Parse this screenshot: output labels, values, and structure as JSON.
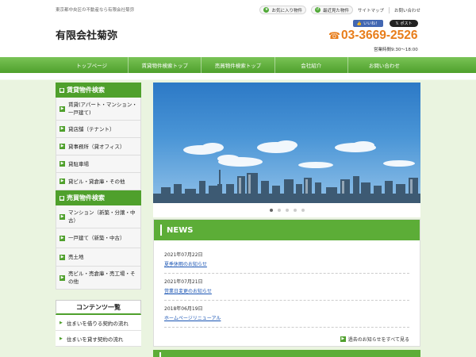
{
  "header": {
    "tagline": "東京都中央区の不動産なら有限会社菊弥",
    "logo": "有限会社菊弥",
    "phone": "03-3669-2526",
    "hours": "営業時間9:30～18:00",
    "util": {
      "favorites": "お気に入り物件",
      "recent": "最近見た物件",
      "sitemap": "サイトマップ",
      "contact": "お問い合わせ"
    },
    "social": {
      "facebook": "いいね！",
      "twitter": "ポスト"
    }
  },
  "nav": [
    "トップページ",
    "賃貸物件検索トップ",
    "売買物件検索トップ",
    "会社紹介",
    "お問い合わせ"
  ],
  "sidebar": {
    "rental_title": "賃貸物件検索",
    "rental_items": [
      "賃貸(アパート・マンション・一戸建て)",
      "貸店舗（テナント）",
      "貸事務所（貸オフィス）",
      "貸駐車場",
      "貸ビル・貸倉庫・その他"
    ],
    "sale_title": "売買物件検索",
    "sale_items": [
      "マンション（新築・分譲・中古）",
      "一戸建て（新築・中古）",
      "売土地",
      "売ビル・売倉庫・売工場・その他"
    ],
    "contents_title": "コンテンツ一覧",
    "contents_items": [
      "住まいを借りる契約の流れ",
      "住まいを貸す契約の流れ"
    ]
  },
  "slider": {
    "dot_count": 5,
    "active_dot": 1
  },
  "news": {
    "title": "NEWS",
    "items": [
      {
        "date": "2021年07月22日",
        "title": "夏季休暇のお知らせ"
      },
      {
        "date": "2021年07月21日",
        "title": "営業日変更のお知らせ"
      },
      {
        "date": "2018年06月19日",
        "title": "ホームページリニューアル"
      }
    ],
    "more": "過去のお知らせをすべて見る"
  },
  "colors": {
    "brand_green": "#4fa02c",
    "phone_orange": "#e87d1a",
    "link_blue": "#1a55b4"
  },
  "icons": {
    "favorites": "star-icon",
    "recent": "history-icon",
    "phone": "phone-icon",
    "list_arrow": "chevron-right-icon"
  }
}
